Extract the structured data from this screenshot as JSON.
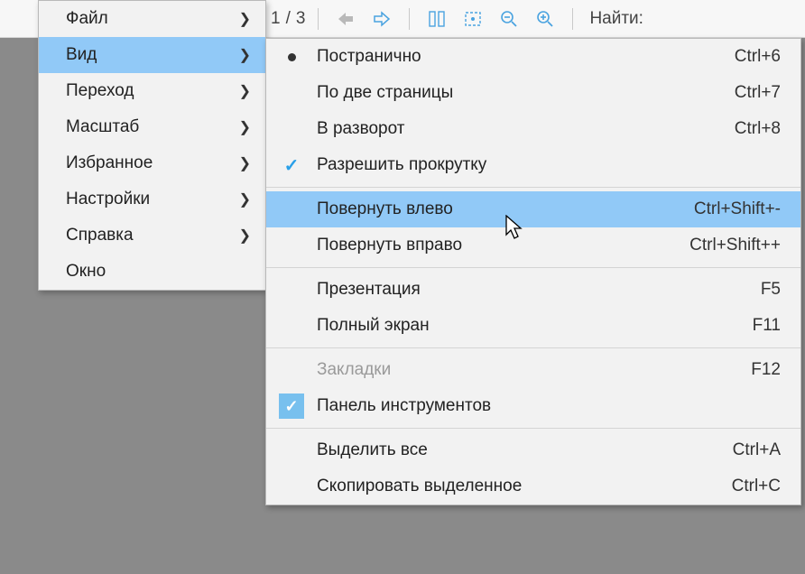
{
  "toolbar": {
    "page_current": "1",
    "page_sep": "/",
    "page_total": "3",
    "find_label": "Найти:"
  },
  "main_menu": {
    "items": [
      {
        "label": "Файл"
      },
      {
        "label": "Вид"
      },
      {
        "label": "Переход"
      },
      {
        "label": "Масштаб"
      },
      {
        "label": "Избранное"
      },
      {
        "label": "Настройки"
      },
      {
        "label": "Справка"
      },
      {
        "label": "Окно"
      }
    ]
  },
  "submenu": {
    "items": [
      {
        "label": "Постранично",
        "shortcut": "Ctrl+6"
      },
      {
        "label": "По две страницы",
        "shortcut": "Ctrl+7"
      },
      {
        "label": "В разворот",
        "shortcut": "Ctrl+8"
      },
      {
        "label": "Разрешить прокрутку",
        "shortcut": ""
      },
      {
        "label": "Повернуть влево",
        "shortcut": "Ctrl+Shift+-"
      },
      {
        "label": "Повернуть вправо",
        "shortcut": "Ctrl+Shift++"
      },
      {
        "label": "Презентация",
        "shortcut": "F5"
      },
      {
        "label": "Полный экран",
        "shortcut": "F11"
      },
      {
        "label": "Закладки",
        "shortcut": "F12"
      },
      {
        "label": "Панель инструментов",
        "shortcut": ""
      },
      {
        "label": "Выделить все",
        "shortcut": "Ctrl+A"
      },
      {
        "label": "Скопировать выделенное",
        "shortcut": "Ctrl+C"
      }
    ]
  }
}
